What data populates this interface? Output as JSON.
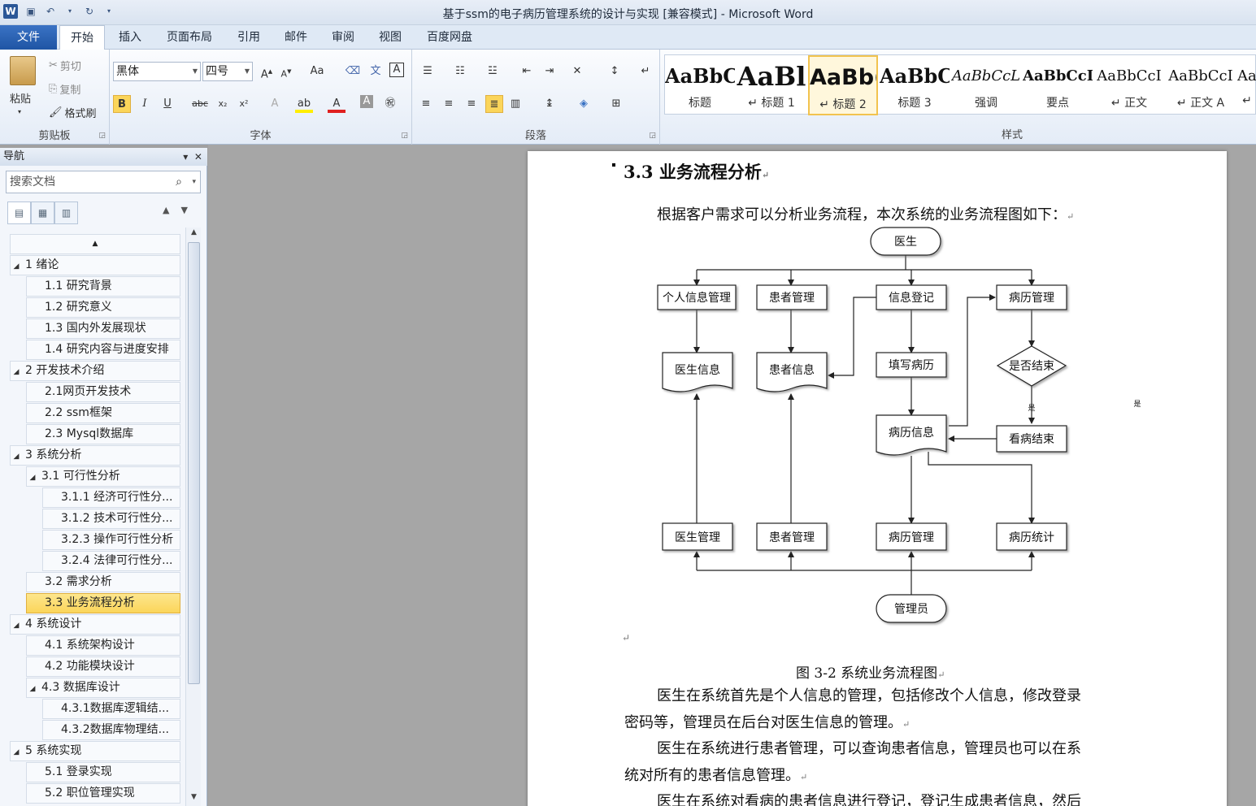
{
  "window": {
    "title": "基于ssm的电子病历管理系统的设计与实现 [兼容模式] - Microsoft Word"
  },
  "qat": {
    "app_icon": "W",
    "save_icon": "save-icon",
    "undo_icon": "undo-icon",
    "redo_icon": "redo-icon"
  },
  "tabs": [
    "文件",
    "开始",
    "插入",
    "页面布局",
    "引用",
    "邮件",
    "审阅",
    "视图",
    "百度网盘"
  ],
  "clipboard": {
    "paste": "粘贴",
    "cut": "剪切",
    "copy": "复制",
    "format_painter": "格式刷",
    "group": "剪贴板"
  },
  "font": {
    "name": "黑体",
    "size": "四号",
    "group": "字体"
  },
  "paragraph": {
    "group": "段落"
  },
  "styles": {
    "group": "样式",
    "items": [
      {
        "sample": "AaBbC(",
        "name": "标题"
      },
      {
        "sample": "AaBl",
        "name": "↵ 标题 1"
      },
      {
        "sample": "AaBb(",
        "name": "↵ 标题 2"
      },
      {
        "sample": "AaBbC",
        "name": "标题 3"
      },
      {
        "sample": "AaBbCcL",
        "name": "强调"
      },
      {
        "sample": "AaBbCcI",
        "name": "要点"
      },
      {
        "sample": "AaBbCcI",
        "name": "↵ 正文"
      },
      {
        "sample": "AaBbCcI",
        "name": "↵ 正文 A"
      },
      {
        "sample": "Aa",
        "name": "↵"
      }
    ]
  },
  "nav": {
    "title": "导航",
    "search_placeholder": "搜索文档",
    "items": [
      {
        "label": "1 绪论",
        "level": 1,
        "toggle": "◢"
      },
      {
        "label": "1.1 研究背景",
        "level": 2
      },
      {
        "label": "1.2 研究意义",
        "level": 2
      },
      {
        "label": "1.3 国内外发展现状",
        "level": 2
      },
      {
        "label": "1.4 研究内容与进度安排",
        "level": 2
      },
      {
        "label": "2 开发技术介绍",
        "level": 1,
        "toggle": "◢"
      },
      {
        "label": "2.1网页开发技术",
        "level": 2
      },
      {
        "label": "2.2 ssm框架",
        "level": 2
      },
      {
        "label": "2.3 Mysql数据库",
        "level": 2
      },
      {
        "label": "3 系统分析",
        "level": 1,
        "toggle": "◢"
      },
      {
        "label": "3.1 可行性分析",
        "level": 2,
        "toggle": "◢"
      },
      {
        "label": "3.1.1 经济可行性分...",
        "level": 3
      },
      {
        "label": "3.1.2 技术可行性分...",
        "level": 3
      },
      {
        "label": "3.2.3 操作可行性分析",
        "level": 3
      },
      {
        "label": "3.2.4 法律可行性分...",
        "level": 3
      },
      {
        "label": "3.2 需求分析",
        "level": 2
      },
      {
        "label": "3.3 业务流程分析",
        "level": 2,
        "selected": true
      },
      {
        "label": "4 系统设计",
        "level": 1,
        "toggle": "◢"
      },
      {
        "label": "4.1 系统架构设计",
        "level": 2
      },
      {
        "label": "4.2 功能模块设计",
        "level": 2
      },
      {
        "label": "4.3 数据库设计",
        "level": 2,
        "toggle": "◢"
      },
      {
        "label": "4.3.1数据库逻辑结...",
        "level": 3
      },
      {
        "label": "4.3.2数据库物理结...",
        "level": 3
      },
      {
        "label": "5 系统实现",
        "level": 1,
        "toggle": "◢"
      },
      {
        "label": "5.1 登录实现",
        "level": 2
      },
      {
        "label": "5.2 职位管理实现",
        "level": 2
      }
    ]
  },
  "doc": {
    "heading": "3.3 业务流程分析",
    "intro": "根据客户需求可以分析业务流程，本次系统的业务流程图如下：",
    "caption": "图 3-2 系统业务流程图",
    "p1a": "医生在系统首先是个人信息的管理，包括修改个人信息，修改登录",
    "p1b": "密码等，管理员在后台对医生信息的管理。",
    "p2a": "医生在系统进行患者管理，可以查询患者信息，管理员也可以在系",
    "p2b": "统对所有的患者信息管理。",
    "p3a": "医生在系统对看病的患者信息进行登记，登记生成患者信息，然后",
    "para_mark": "↵",
    "flow": {
      "doctor": "医生",
      "admin": "管理员",
      "personal_mgmt": "个人信息管理",
      "patient_mgmt": "患者管理",
      "info_register": "信息登记",
      "record_mgmt": "病历管理",
      "doctor_info": "医生信息",
      "patient_info": "患者信息",
      "fill_record": "填写病历",
      "is_end": "是否结束",
      "yes": "是",
      "record_info": "病历信息",
      "visit_end": "看病结束",
      "doctor_mgmt": "医生管理",
      "patient_mgmt2": "患者管理",
      "record_mgmt2": "病历管理",
      "record_stats": "病历统计"
    }
  }
}
